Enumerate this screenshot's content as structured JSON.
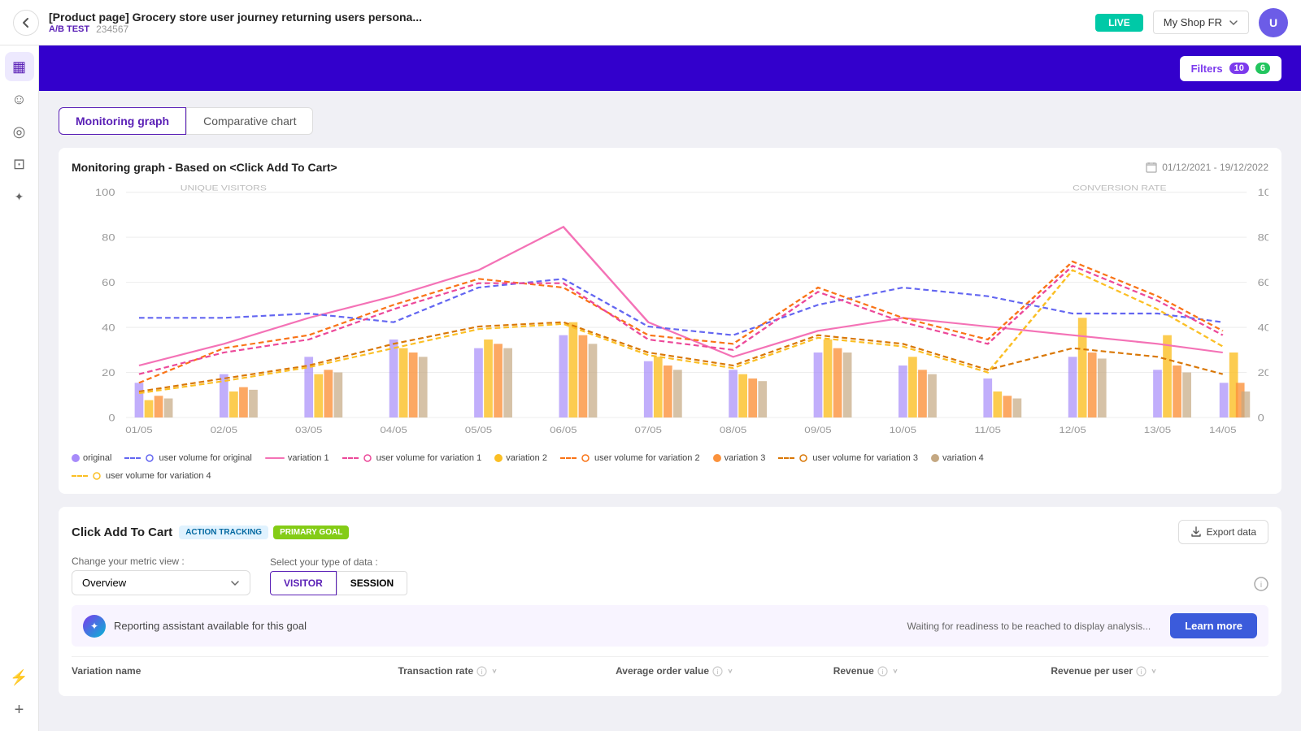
{
  "header": {
    "back_label": "←",
    "title": "[Product page] Grocery store user journey returning users persona...",
    "ab_test": "A/B TEST",
    "test_id": "234567",
    "live_label": "LIVE",
    "shop_selector": "My Shop FR",
    "filters_label": "Filters",
    "filter_count": "10",
    "filter_active": "6"
  },
  "tabs": [
    {
      "id": "monitoring",
      "label": "Monitoring graph",
      "active": true
    },
    {
      "id": "comparative",
      "label": "Comparative chart",
      "active": false
    }
  ],
  "chart": {
    "title": "Monitoring graph  -  Based on <Click Add To Cart>",
    "date_range": "01/12/2021 - 19/12/2022",
    "y_left_label": "UNIQUE VISITORS",
    "y_right_label": "CONVERSION RATE",
    "x_labels": [
      "01/05",
      "02/05",
      "03/05",
      "04/05",
      "05/05",
      "06/05",
      "07/05",
      "08/05",
      "09/05",
      "10/05",
      "11/05",
      "12/05",
      "13/05",
      "14/05"
    ],
    "y_values": [
      0,
      20,
      40,
      60,
      80,
      100
    ],
    "legend": [
      {
        "id": "original",
        "label": "original",
        "color": "#a78bfa",
        "type": "bar"
      },
      {
        "id": "user_vol_original",
        "label": "user volume for original",
        "color": "#6366f1",
        "type": "line-dashed"
      },
      {
        "id": "variation1",
        "label": "variation 1",
        "color": "#f472b6",
        "type": "line"
      },
      {
        "id": "user_vol_v1",
        "label": "user volume for variation 1",
        "color": "#ec4899",
        "type": "line-dashed"
      },
      {
        "id": "variation2",
        "label": "variation 2",
        "color": "#fbbf24",
        "type": "bar"
      },
      {
        "id": "user_vol_v2",
        "label": "user volume for variation 2",
        "color": "#f97316",
        "type": "line-dashed"
      },
      {
        "id": "variation3",
        "label": "variation 3",
        "color": "#fb923c",
        "type": "bar"
      },
      {
        "id": "user_vol_v3",
        "label": "user volume for variation 3",
        "color": "#d97706",
        "type": "line-dashed"
      },
      {
        "id": "variation4",
        "label": "variation 4",
        "color": "#d1c4a8",
        "type": "bar"
      },
      {
        "id": "user_vol_v4",
        "label": "user volume for variation 4",
        "color": "#fbbf24",
        "type": "line-dashed"
      }
    ]
  },
  "goal_section": {
    "title": "Click Add To Cart",
    "badge_action": "ACTION TRACKING",
    "badge_primary": "PRIMARY GOAL",
    "export_label": "Export data",
    "metric_label": "Change your metric view :",
    "metric_value": "Overview",
    "data_type_label": "Select your type of data :",
    "visitor_btn": "VISITOR",
    "session_btn": "SESSION",
    "assistant_text": "Reporting assistant available for this goal",
    "waiting_text": "Waiting for readiness to be reached to display analysis...",
    "learn_more": "Learn more",
    "table_headers": [
      {
        "label": "Variation name",
        "has_info": false,
        "has_sort": false
      },
      {
        "label": "Transaction rate",
        "has_info": true,
        "has_sort": true
      },
      {
        "label": "Average order value",
        "has_info": true,
        "has_sort": true
      },
      {
        "label": "Revenue",
        "has_info": true,
        "has_sort": true
      },
      {
        "label": "Revenue per user",
        "has_info": true,
        "has_sort": true
      }
    ]
  },
  "sidebar_icons": [
    {
      "id": "dashboard",
      "icon": "▦",
      "active": true
    },
    {
      "id": "smiley",
      "icon": "☺",
      "active": false
    },
    {
      "id": "target",
      "icon": "◎",
      "active": false
    },
    {
      "id": "layers",
      "icon": "⊡",
      "active": false
    },
    {
      "id": "magic",
      "icon": "✦",
      "active": false
    },
    {
      "id": "bolt",
      "icon": "⚡",
      "active": false
    },
    {
      "id": "plus",
      "icon": "＋",
      "active": false
    }
  ]
}
